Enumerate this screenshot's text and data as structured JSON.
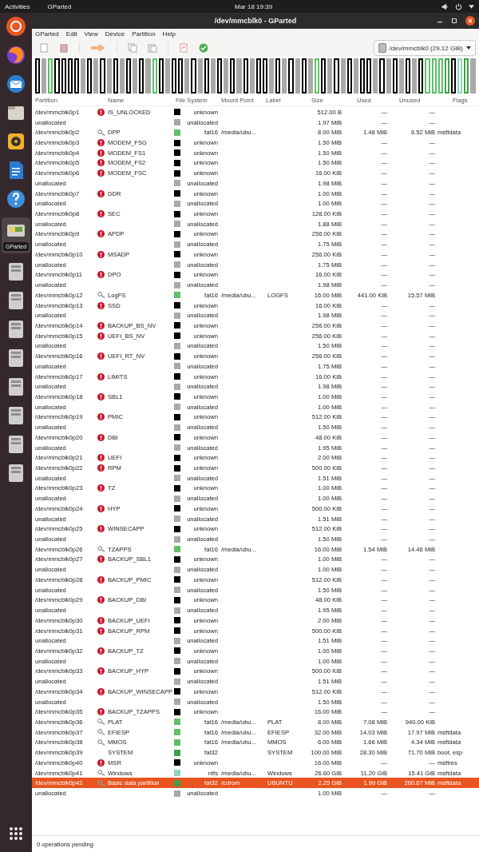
{
  "top_bar": {
    "activities": "Activities",
    "app_menu": "GParted",
    "clock": "Mar 18  19:39"
  },
  "dock": {
    "tooltip": "GParted"
  },
  "window": {
    "title": "/dev/mmcblk0 - GParted"
  },
  "menu": [
    "GParted",
    "Edit",
    "View",
    "Device",
    "Partition",
    "Help"
  ],
  "device_selector": "/dev/mmcblk0 (29.12 GiB)",
  "table": {
    "columns": [
      "Partition",
      "Name",
      "File System",
      "Mount Point",
      "Label",
      "Size",
      "Used",
      "Unused",
      "Flags"
    ],
    "rows": [
      {
        "partition": "/dev/mmcblk0p1",
        "kind": "error",
        "name": "IS_UNLOCKED",
        "fs": "unknown",
        "color": "#000000",
        "size": "512.00 B",
        "used": "—",
        "unused": "—",
        "selected": false
      },
      {
        "partition": "unallocated",
        "kind": "free",
        "fs": "unallocated",
        "color": "#a9a9a9",
        "size": "1.97 MiB",
        "used": "—",
        "unused": "—",
        "selected": false
      },
      {
        "partition": "/dev/mmcblk0p2",
        "kind": "mounted",
        "name": "DPP",
        "fs": "fat16",
        "color": "#5fbf6a",
        "mount": "/media/ubu...",
        "size": "8.00 MiB",
        "used": "1.48 MiB",
        "unused": "6.52 MiB",
        "flags": "msftdata",
        "selected": false
      },
      {
        "partition": "/dev/mmcblk0p3",
        "kind": "error",
        "name": "MODEM_FSG",
        "fs": "unknown",
        "color": "#000000",
        "size": "1.50 MiB",
        "used": "—",
        "unused": "—",
        "selected": false
      },
      {
        "partition": "/dev/mmcblk0p4",
        "kind": "error",
        "name": "MODEM_FS1",
        "fs": "unknown",
        "color": "#000000",
        "size": "1.50 MiB",
        "used": "—",
        "unused": "—",
        "selected": false
      },
      {
        "partition": "/dev/mmcblk0p5",
        "kind": "error",
        "name": "MODEM_FS2",
        "fs": "unknown",
        "color": "#000000",
        "size": "1.50 MiB",
        "used": "—",
        "unused": "—",
        "selected": false
      },
      {
        "partition": "/dev/mmcblk0p6",
        "kind": "error",
        "name": "MODEM_FSC",
        "fs": "unknown",
        "color": "#000000",
        "size": "16.00 KiB",
        "used": "—",
        "unused": "—",
        "selected": false
      },
      {
        "partition": "unallocated",
        "kind": "free",
        "fs": "unallocated",
        "color": "#a9a9a9",
        "size": "1.98 MiB",
        "used": "—",
        "unused": "—",
        "selected": false
      },
      {
        "partition": "/dev/mmcblk0p7",
        "kind": "error",
        "name": "DDR",
        "fs": "unknown",
        "color": "#000000",
        "size": "1.00 MiB",
        "used": "—",
        "unused": "—",
        "selected": false
      },
      {
        "partition": "unallocated",
        "kind": "free",
        "fs": "unallocated",
        "color": "#a9a9a9",
        "size": "1.00 MiB",
        "used": "—",
        "unused": "—",
        "selected": false
      },
      {
        "partition": "/dev/mmcblk0p8",
        "kind": "error",
        "name": "SEC",
        "fs": "unknown",
        "color": "#000000",
        "size": "128.00 KiB",
        "used": "—",
        "unused": "—",
        "selected": false
      },
      {
        "partition": "unallocated",
        "kind": "free",
        "fs": "unallocated",
        "color": "#a9a9a9",
        "size": "1.88 MiB",
        "used": "—",
        "unused": "—",
        "selected": false
      },
      {
        "partition": "/dev/mmcblk0p9",
        "kind": "error",
        "name": "APDP",
        "fs": "unknown",
        "color": "#000000",
        "size": "256.00 KiB",
        "used": "—",
        "unused": "—",
        "selected": false
      },
      {
        "partition": "unallocated",
        "kind": "free",
        "fs": "unallocated",
        "color": "#a9a9a9",
        "size": "1.75 MiB",
        "used": "—",
        "unused": "—",
        "selected": false
      },
      {
        "partition": "/dev/mmcblk0p10",
        "kind": "error",
        "name": "MSADP",
        "fs": "unknown",
        "color": "#000000",
        "size": "256.00 KiB",
        "used": "—",
        "unused": "—",
        "selected": false
      },
      {
        "partition": "unallocated",
        "kind": "free",
        "fs": "unallocated",
        "color": "#a9a9a9",
        "size": "1.75 MiB",
        "used": "—",
        "unused": "—",
        "selected": false
      },
      {
        "partition": "/dev/mmcblk0p11",
        "kind": "error",
        "name": "DPO",
        "fs": "unknown",
        "color": "#000000",
        "size": "16.00 KiB",
        "used": "—",
        "unused": "—",
        "selected": false
      },
      {
        "partition": "unallocated",
        "kind": "free",
        "fs": "unallocated",
        "color": "#a9a9a9",
        "size": "1.98 MiB",
        "used": "—",
        "unused": "—",
        "selected": false
      },
      {
        "partition": "/dev/mmcblk0p12",
        "kind": "mounted",
        "name": "LogFS",
        "fs": "fat16",
        "color": "#5fbf6a",
        "mount": "/media/ubu...",
        "label": "LOGFS",
        "size": "16.00 MiB",
        "used": "441.00 KiB",
        "unused": "15.57 MiB",
        "selected": false
      },
      {
        "partition": "/dev/mmcblk0p13",
        "kind": "error",
        "name": "SSD",
        "fs": "unknown",
        "color": "#000000",
        "size": "16.00 KiB",
        "used": "—",
        "unused": "—",
        "selected": false
      },
      {
        "partition": "unallocated",
        "kind": "free",
        "fs": "unallocated",
        "color": "#a9a9a9",
        "size": "1.98 MiB",
        "used": "—",
        "unused": "—",
        "selected": false
      },
      {
        "partition": "/dev/mmcblk0p14",
        "kind": "error",
        "name": "BACKUP_BS_NV",
        "fs": "unknown",
        "color": "#000000",
        "size": "256.00 KiB",
        "used": "—",
        "unused": "—",
        "selected": false
      },
      {
        "partition": "/dev/mmcblk0p15",
        "kind": "error",
        "name": "UEFI_BS_NV",
        "fs": "unknown",
        "color": "#000000",
        "size": "256.00 KiB",
        "used": "—",
        "unused": "—",
        "selected": false
      },
      {
        "partition": "unallocated",
        "kind": "free",
        "fs": "unallocated",
        "color": "#a9a9a9",
        "size": "1.50 MiB",
        "used": "—",
        "unused": "—",
        "selected": false
      },
      {
        "partition": "/dev/mmcblk0p16",
        "kind": "error",
        "name": "UEFI_RT_NV",
        "fs": "unknown",
        "color": "#000000",
        "size": "256.00 KiB",
        "used": "—",
        "unused": "—",
        "selected": false
      },
      {
        "partition": "unallocated",
        "kind": "free",
        "fs": "unallocated",
        "color": "#a9a9a9",
        "size": "1.75 MiB",
        "used": "—",
        "unused": "—",
        "selected": false
      },
      {
        "partition": "/dev/mmcblk0p17",
        "kind": "error",
        "name": "LIMITS",
        "fs": "unknown",
        "color": "#000000",
        "size": "16.00 KiB",
        "used": "—",
        "unused": "—",
        "selected": false
      },
      {
        "partition": "unallocated",
        "kind": "free",
        "fs": "unallocated",
        "color": "#a9a9a9",
        "size": "1.98 MiB",
        "used": "—",
        "unused": "—",
        "selected": false
      },
      {
        "partition": "/dev/mmcblk0p18",
        "kind": "error",
        "name": "SBL1",
        "fs": "unknown",
        "color": "#000000",
        "size": "1.00 MiB",
        "used": "—",
        "unused": "—",
        "selected": false
      },
      {
        "partition": "unallocated",
        "kind": "free",
        "fs": "unallocated",
        "color": "#a9a9a9",
        "size": "1.00 MiB",
        "used": "—",
        "unused": "—",
        "selected": false
      },
      {
        "partition": "/dev/mmcblk0p19",
        "kind": "error",
        "name": "PMIC",
        "fs": "unknown",
        "color": "#000000",
        "size": "512.00 KiB",
        "used": "—",
        "unused": "—",
        "selected": false
      },
      {
        "partition": "unallocated",
        "kind": "free",
        "fs": "unallocated",
        "color": "#a9a9a9",
        "size": "1.50 MiB",
        "used": "—",
        "unused": "—",
        "selected": false
      },
      {
        "partition": "/dev/mmcblk0p20",
        "kind": "error",
        "name": "DBI",
        "fs": "unknown",
        "color": "#000000",
        "size": "48.00 KiB",
        "used": "—",
        "unused": "—",
        "selected": false
      },
      {
        "partition": "unallocated",
        "kind": "free",
        "fs": "unallocated",
        "color": "#a9a9a9",
        "size": "1.95 MiB",
        "used": "—",
        "unused": "—",
        "selected": false
      },
      {
        "partition": "/dev/mmcblk0p21",
        "kind": "error",
        "name": "UEFI",
        "fs": "unknown",
        "color": "#000000",
        "size": "2.00 MiB",
        "used": "—",
        "unused": "—",
        "selected": false
      },
      {
        "partition": "/dev/mmcblk0p22",
        "kind": "error",
        "name": "RPM",
        "fs": "unknown",
        "color": "#000000",
        "size": "500.00 KiB",
        "used": "—",
        "unused": "—",
        "selected": false
      },
      {
        "partition": "unallocated",
        "kind": "free",
        "fs": "unallocated",
        "color": "#a9a9a9",
        "size": "1.51 MiB",
        "used": "—",
        "unused": "—",
        "selected": false
      },
      {
        "partition": "/dev/mmcblk0p23",
        "kind": "error",
        "name": "TZ",
        "fs": "unknown",
        "color": "#000000",
        "size": "1.00 MiB",
        "used": "—",
        "unused": "—",
        "selected": false
      },
      {
        "partition": "unallocated",
        "kind": "free",
        "fs": "unallocated",
        "color": "#a9a9a9",
        "size": "1.00 MiB",
        "used": "—",
        "unused": "—",
        "selected": false
      },
      {
        "partition": "/dev/mmcblk0p24",
        "kind": "error",
        "name": "HYP",
        "fs": "unknown",
        "color": "#000000",
        "size": "500.00 KiB",
        "used": "—",
        "unused": "—",
        "selected": false
      },
      {
        "partition": "unallocated",
        "kind": "free",
        "fs": "unallocated",
        "color": "#a9a9a9",
        "size": "1.51 MiB",
        "used": "—",
        "unused": "—",
        "selected": false
      },
      {
        "partition": "/dev/mmcblk0p25",
        "kind": "error",
        "name": "WINSECAPP",
        "fs": "unknown",
        "color": "#000000",
        "size": "512.00 KiB",
        "used": "—",
        "unused": "—",
        "selected": false
      },
      {
        "partition": "unallocated",
        "kind": "free",
        "fs": "unallocated",
        "color": "#a9a9a9",
        "size": "1.50 MiB",
        "used": "—",
        "unused": "—",
        "selected": false
      },
      {
        "partition": "/dev/mmcblk0p26",
        "kind": "mounted",
        "name": "TZAPPS",
        "fs": "fat16",
        "color": "#5fbf6a",
        "mount": "/media/ubu...",
        "size": "16.00 MiB",
        "used": "1.54 MiB",
        "unused": "14.46 MiB",
        "selected": false
      },
      {
        "partition": "/dev/mmcblk0p27",
        "kind": "error",
        "name": "BACKUP_SBL1",
        "fs": "unknown",
        "color": "#000000",
        "size": "1.00 MiB",
        "used": "—",
        "unused": "—",
        "selected": false
      },
      {
        "partition": "unallocated",
        "kind": "free",
        "fs": "unallocated",
        "color": "#a9a9a9",
        "size": "1.00 MiB",
        "used": "—",
        "unused": "—",
        "selected": false
      },
      {
        "partition": "/dev/mmcblk0p28",
        "kind": "error",
        "name": "BACKUP_PMIC",
        "fs": "unknown",
        "color": "#000000",
        "size": "512.00 KiB",
        "used": "—",
        "unused": "—",
        "selected": false
      },
      {
        "partition": "unallocated",
        "kind": "free",
        "fs": "unallocated",
        "color": "#a9a9a9",
        "size": "1.50 MiB",
        "used": "—",
        "unused": "—",
        "selected": false
      },
      {
        "partition": "/dev/mmcblk0p29",
        "kind": "error",
        "name": "BACKUP_DBI",
        "fs": "unknown",
        "color": "#000000",
        "size": "48.00 KiB",
        "used": "—",
        "unused": "—",
        "selected": false
      },
      {
        "partition": "unallocated",
        "kind": "free",
        "fs": "unallocated",
        "color": "#a9a9a9",
        "size": "1.95 MiB",
        "used": "—",
        "unused": "—",
        "selected": false
      },
      {
        "partition": "/dev/mmcblk0p30",
        "kind": "error",
        "name": "BACKUP_UEFI",
        "fs": "unknown",
        "color": "#000000",
        "size": "2.00 MiB",
        "used": "—",
        "unused": "—",
        "selected": false
      },
      {
        "partition": "/dev/mmcblk0p31",
        "kind": "error",
        "name": "BACKUP_RPM",
        "fs": "unknown",
        "color": "#000000",
        "size": "500.00 KiB",
        "used": "—",
        "unused": "—",
        "selected": false
      },
      {
        "partition": "unallocated",
        "kind": "free",
        "fs": "unallocated",
        "color": "#a9a9a9",
        "size": "1.51 MiB",
        "used": "—",
        "unused": "—",
        "selected": false
      },
      {
        "partition": "/dev/mmcblk0p32",
        "kind": "error",
        "name": "BACKUP_TZ",
        "fs": "unknown",
        "color": "#000000",
        "size": "1.00 MiB",
        "used": "—",
        "unused": "—",
        "selected": false
      },
      {
        "partition": "unallocated",
        "kind": "free",
        "fs": "unallocated",
        "color": "#a9a9a9",
        "size": "1.00 MiB",
        "used": "—",
        "unused": "—",
        "selected": false
      },
      {
        "partition": "/dev/mmcblk0p33",
        "kind": "error",
        "name": "BACKUP_HYP",
        "fs": "unknown",
        "color": "#000000",
        "size": "500.00 KiB",
        "used": "—",
        "unused": "—",
        "selected": false
      },
      {
        "partition": "unallocated",
        "kind": "free",
        "fs": "unallocated",
        "color": "#a9a9a9",
        "size": "1.51 MiB",
        "used": "—",
        "unused": "—",
        "selected": false
      },
      {
        "partition": "/dev/mmcblk0p34",
        "kind": "error",
        "name": "BACKUP_WINSECAPP",
        "fs": "unknown",
        "color": "#000000",
        "size": "512.00 KiB",
        "used": "—",
        "unused": "—",
        "selected": false
      },
      {
        "partition": "unallocated",
        "kind": "free",
        "fs": "unallocated",
        "color": "#a9a9a9",
        "size": "1.50 MiB",
        "used": "—",
        "unused": "—",
        "selected": false
      },
      {
        "partition": "/dev/mmcblk0p35",
        "kind": "error",
        "name": "BACKUP_TZAPPS",
        "fs": "unknown",
        "color": "#000000",
        "size": "16.00 MiB",
        "used": "—",
        "unused": "—",
        "selected": false
      },
      {
        "partition": "/dev/mmcblk0p36",
        "kind": "mounted",
        "name": "PLAT",
        "fs": "fat16",
        "color": "#5fbf6a",
        "mount": "/media/ubu...",
        "label": "PLAT",
        "size": "8.00 MiB",
        "used": "7.08 MiB",
        "unused": "940.00 KiB",
        "selected": false
      },
      {
        "partition": "/dev/mmcblk0p37",
        "kind": "mounted",
        "name": "EFIESP",
        "fs": "fat16",
        "color": "#5fbf6a",
        "mount": "/media/ubu...",
        "label": "EFIESP",
        "size": "32.00 MiB",
        "used": "14.03 MiB",
        "unused": "17.97 MiB",
        "flags": "msftdata",
        "selected": false
      },
      {
        "partition": "/dev/mmcblk0p38",
        "kind": "mounted",
        "name": "MMOS",
        "fs": "fat16",
        "color": "#5fbf6a",
        "mount": "/media/ubu...",
        "label": "MMOS",
        "size": "6.00 MiB",
        "used": "1.66 MiB",
        "unused": "4.34 MiB",
        "flags": "msftdata",
        "selected": false
      },
      {
        "partition": "/dev/mmcblk0p39",
        "kind": "plain",
        "name": "SYSTEM",
        "fs": "fat32",
        "color": "#3f9f4a",
        "label": "SYSTEM",
        "size": "100.00 MiB",
        "used": "28.30 MiB",
        "unused": "71.70 MiB",
        "flags": "boot, esp",
        "selected": false
      },
      {
        "partition": "/dev/mmcblk0p40",
        "kind": "error",
        "name": "MSR",
        "fs": "unknown",
        "color": "#000000",
        "size": "16.00 MiB",
        "used": "—",
        "unused": "—",
        "flags": "msftres",
        "selected": false
      },
      {
        "partition": "/dev/mmcblk0p41",
        "kind": "mounted",
        "name": "Windows",
        "fs": "ntfs",
        "color": "#8ed4b6",
        "mount": "/media/ubu...",
        "label": "Windows",
        "size": "26.60 GiB",
        "used": "11.20 GiB",
        "unused": "15.41 GiB",
        "flags": "msftdata",
        "selected": false
      },
      {
        "partition": "/dev/mmcblk0p42",
        "kind": "mounted",
        "name": "Basic data partition",
        "fs": "fat32",
        "color": "#3f9f4a",
        "mount": "/cdrom",
        "label": "UBUNTU",
        "size": "2.25 GiB",
        "used": "1.99 GiB",
        "unused": "260.67 MiB",
        "flags": "msftdata",
        "selected": true
      },
      {
        "partition": "unallocated",
        "kind": "free",
        "fs": "unallocated",
        "color": "#a9a9a9",
        "size": "1.00 MiB",
        "used": "—",
        "unused": "—",
        "selected": false
      }
    ]
  },
  "status_bar": "0 operations pending"
}
